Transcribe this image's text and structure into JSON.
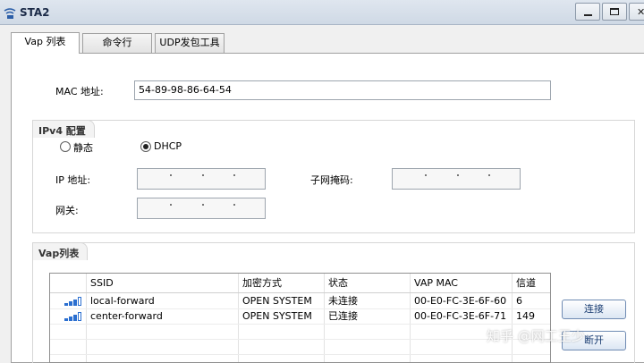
{
  "window": {
    "title": "STA2"
  },
  "tabs": [
    {
      "label": "Vap 列表"
    },
    {
      "label": "命令行"
    },
    {
      "label": "UDP发包工具"
    }
  ],
  "mac": {
    "label": "MAC 地址:",
    "value": "54-89-98-86-64-54"
  },
  "ipv4": {
    "title": "IPv4 配置",
    "static_label": "静态",
    "dhcp_label": "DHCP",
    "selected": "DHCP",
    "ip_label": "IP 地址:",
    "mask_label": "子网掩码:",
    "gateway_label": "网关:"
  },
  "vap": {
    "title": "Vap列表",
    "columns": [
      "",
      "SSID",
      "加密方式",
      "状态",
      "VAP MAC",
      "信道"
    ],
    "rows": [
      {
        "signal": "signal-icon",
        "ssid": "local-forward",
        "encryption": "OPEN SYSTEM",
        "status": "未连接",
        "mac": "00-E0-FC-3E-6F-60",
        "channel": "6"
      },
      {
        "signal": "signal-icon",
        "ssid": "center-forward",
        "encryption": "OPEN SYSTEM",
        "status": "已连接",
        "mac": "00-E0-FC-3E-6F-71",
        "channel": "149"
      }
    ]
  },
  "buttons": {
    "connect": "连接",
    "disconnect": "断开"
  },
  "watermark": "知乎 @网工王少"
}
